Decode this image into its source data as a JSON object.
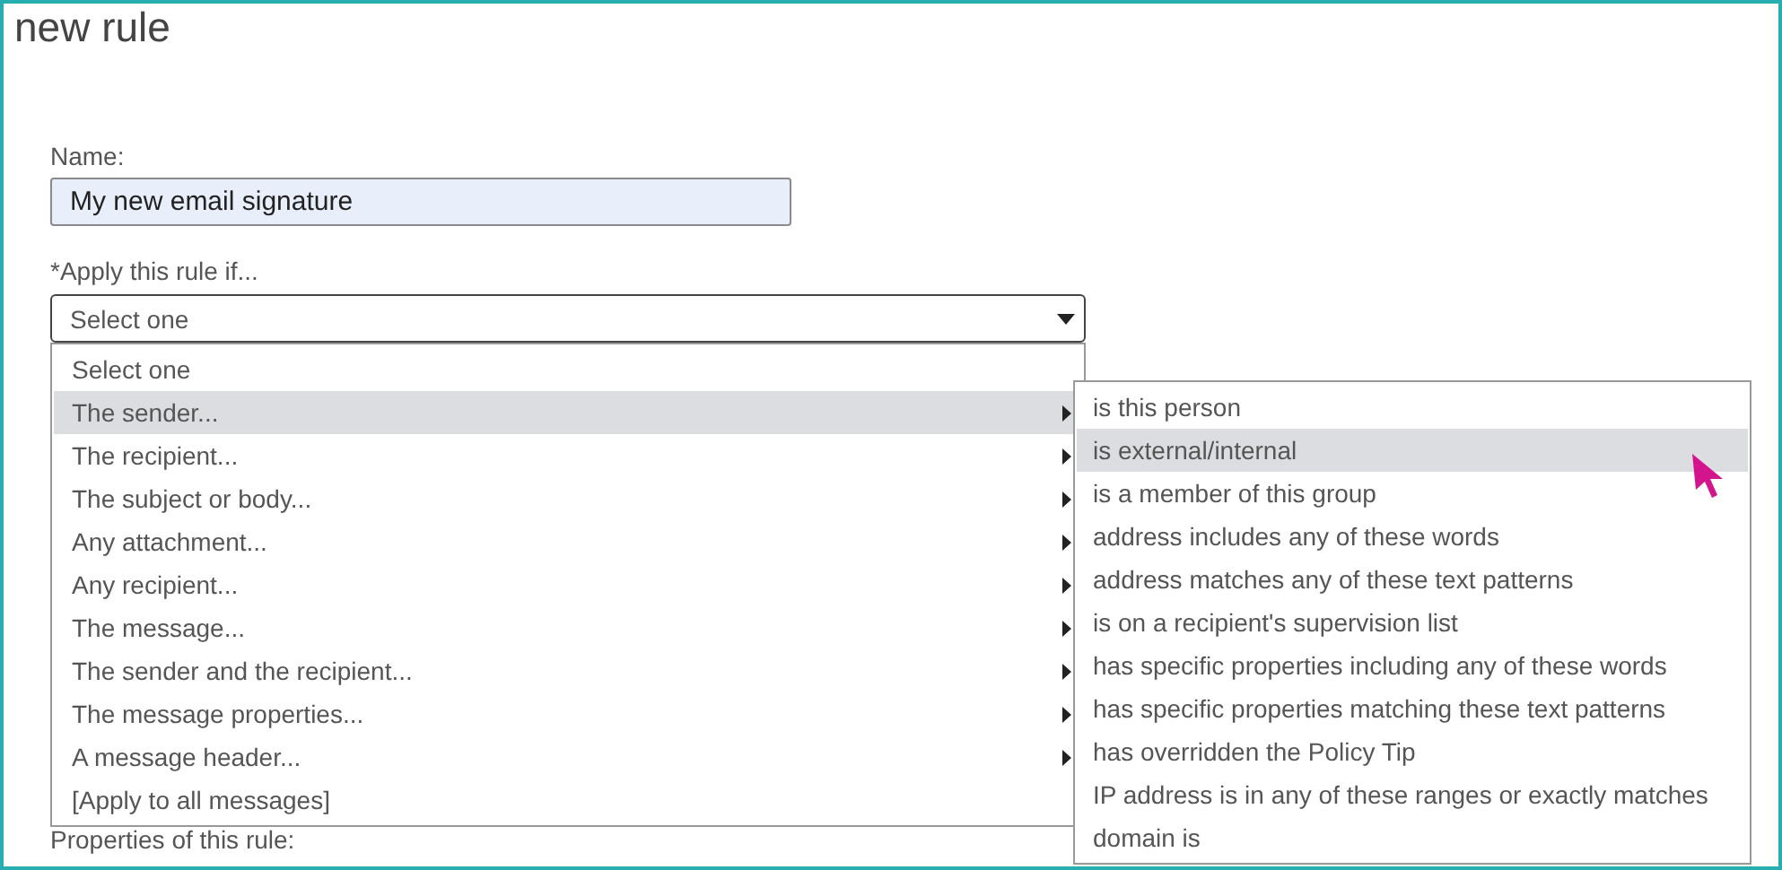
{
  "page": {
    "title": "new rule"
  },
  "name_field": {
    "label": "Name:",
    "value": "My new email signature"
  },
  "condition_field": {
    "label": "*Apply this rule if...",
    "value": "Select one",
    "expanded": true
  },
  "condition_options": [
    {
      "label": "Select one",
      "submenu": false,
      "selected": false
    },
    {
      "label": "The sender...",
      "submenu": true,
      "selected": true
    },
    {
      "label": "The recipient...",
      "submenu": true,
      "selected": false
    },
    {
      "label": "The subject or body...",
      "submenu": true,
      "selected": false
    },
    {
      "label": "Any attachment...",
      "submenu": true,
      "selected": false
    },
    {
      "label": "Any recipient...",
      "submenu": true,
      "selected": false
    },
    {
      "label": "The message...",
      "submenu": true,
      "selected": false
    },
    {
      "label": "The sender and the recipient...",
      "submenu": true,
      "selected": false
    },
    {
      "label": "The message properties...",
      "submenu": true,
      "selected": false
    },
    {
      "label": "A message header...",
      "submenu": true,
      "selected": false
    },
    {
      "label": "[Apply to all messages]",
      "submenu": false,
      "selected": false
    }
  ],
  "sender_submenu": [
    {
      "label": "is this person",
      "selected": false
    },
    {
      "label": "is external/internal",
      "selected": true
    },
    {
      "label": "is a member of this group",
      "selected": false
    },
    {
      "label": "address includes any of these words",
      "selected": false
    },
    {
      "label": "address matches any of these text patterns",
      "selected": false
    },
    {
      "label": "is on a recipient's supervision list",
      "selected": false
    },
    {
      "label": "has specific properties including any of these words",
      "selected": false
    },
    {
      "label": "has specific properties matching these text patterns",
      "selected": false
    },
    {
      "label": "has overridden the Policy Tip",
      "selected": false
    },
    {
      "label": "IP address is in any of these ranges or exactly matches",
      "selected": false
    },
    {
      "label": "domain is",
      "selected": false
    }
  ],
  "properties_label": "Properties of this rule:"
}
